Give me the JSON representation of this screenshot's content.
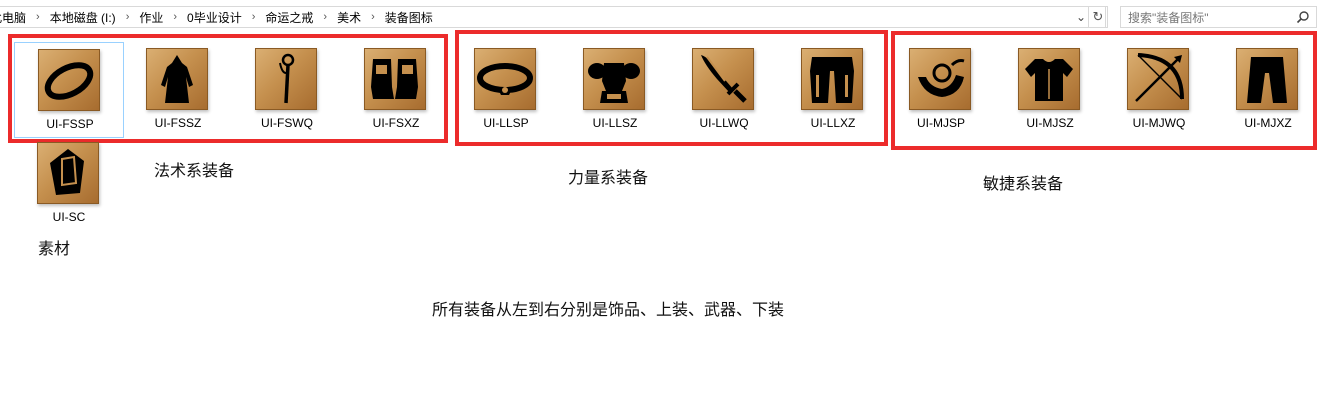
{
  "breadcrumb": [
    "此电脑",
    "本地磁盘 (I:)",
    "作业",
    "0毕业设计",
    "命运之戒",
    "美术",
    "装备图标"
  ],
  "search": {
    "placeholder": "搜索\"装备图标\""
  },
  "items": [
    {
      "label": "UI-FSSP",
      "icon": "ring-icon"
    },
    {
      "label": "UI-FSSZ",
      "icon": "robe-icon"
    },
    {
      "label": "UI-FSWQ",
      "icon": "staff-icon"
    },
    {
      "label": "UI-FSXZ",
      "icon": "boots-icon"
    },
    {
      "label": "UI-LLSP",
      "icon": "belt-icon"
    },
    {
      "label": "UI-LLSZ",
      "icon": "plate-armor-icon"
    },
    {
      "label": "UI-LLWQ",
      "icon": "sword-icon"
    },
    {
      "label": "UI-LLXZ",
      "icon": "greaves-icon"
    },
    {
      "label": "UI-MJSP",
      "icon": "necklace-icon"
    },
    {
      "label": "UI-MJSZ",
      "icon": "vest-icon"
    },
    {
      "label": "UI-MJWQ",
      "icon": "bow-icon"
    },
    {
      "label": "UI-MJXZ",
      "icon": "pants-icon"
    },
    {
      "label": "UI-SC",
      "icon": "gem-icon"
    }
  ],
  "notes": {
    "magic": "法术系装备",
    "strength": "力量系装备",
    "agility": "敏捷系装备",
    "material": "素材",
    "summary": "所有装备从左到右分别是饰品、上装、武器、下装"
  }
}
